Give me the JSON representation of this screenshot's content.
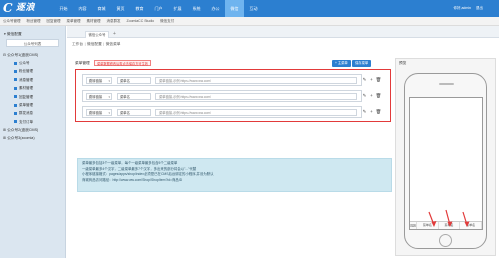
{
  "app": {
    "logo_mark": "C",
    "logo_text": "逐浪"
  },
  "topnav": {
    "items": [
      "开始",
      "内容",
      "商城",
      "黄页",
      "教育",
      "门户",
      "扩展",
      "系统",
      "办公",
      "微信",
      "互动"
    ],
    "active_index": 9
  },
  "user": {
    "greeting": "你好,admin",
    "logout": "退出"
  },
  "subbar": {
    "items": [
      "公众号管理",
      "粉丝管理",
      "回复管理",
      "菜单管理",
      "素材管理",
      "消息群发",
      "ZoomlaCC Studio",
      "微信支付"
    ]
  },
  "sidebar": {
    "section_title": "▾ 微信配置",
    "current_item": "公众号列表",
    "group1_title": "⊟ 公众号1(逐浪CMS)",
    "group1_items": [
      "公众号",
      "粉丝管理",
      "消息管理",
      "素材管理",
      "回复管理",
      "菜单管理",
      "群发消息",
      "支付订单"
    ],
    "group2_title": "⊞ 公众号2(逐浪CMS)",
    "group3_title": "⊞ 公众号3(zoomla)"
  },
  "main": {
    "tab_label": "微信公众号",
    "tab_add": "+",
    "breadcrumb": [
      "工作台",
      "微信配置",
      "微信菜单"
    ],
    "panel_label": "菜单管理",
    "warning": "菜单数据修改后需点击保存方可生效",
    "add_button": "+ 主菜单",
    "save_button": "保存菜单",
    "rows": [
      {
        "type": "跳转链接",
        "name": "菜单名",
        "url": "菜单链接,示例:https://www.ww.com/"
      },
      {
        "type": "跳转链接",
        "name": "菜单名",
        "url": "菜单链接,示例:https://www.ww.com/"
      },
      {
        "type": "跳转链接",
        "name": "菜单名",
        "url": "菜单链接,示例:https://www.ww.com/"
      }
    ],
    "tools": {
      "edit": "✎",
      "add": "+",
      "delete": "🗑"
    },
    "info": [
      "菜单最多包括3个一级菜单，每个一级菜单最多包含5个二级菜单",
      "一级菜单最多4个汉字，二级菜单最多7个汉字，多出来的部分将会以\"...\"代替",
      "小程序链接格式：pages/apps/shop/index必须是已在CMS后台绑定的小程序,并设为默认",
      "商城商品访问路径：http://www.ww.com/Shop/ShopItem?id=商品ID"
    ]
  },
  "preview": {
    "title": "预览",
    "keyboard_icon": "⌨",
    "menus": [
      "菜单名",
      "菜单名",
      "菜单名"
    ]
  }
}
